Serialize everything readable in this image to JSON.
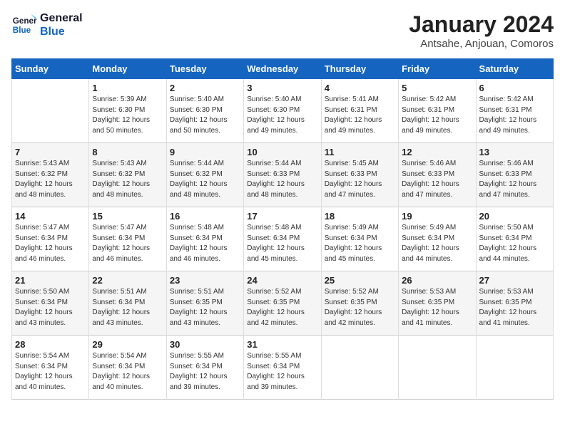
{
  "logo": {
    "line1": "General",
    "line2": "Blue"
  },
  "title": "January 2024",
  "subtitle": "Antsahe, Anjouan, Comoros",
  "days_of_week": [
    "Sunday",
    "Monday",
    "Tuesday",
    "Wednesday",
    "Thursday",
    "Friday",
    "Saturday"
  ],
  "weeks": [
    [
      {
        "num": "",
        "info": ""
      },
      {
        "num": "1",
        "info": "Sunrise: 5:39 AM\nSunset: 6:30 PM\nDaylight: 12 hours\nand 50 minutes."
      },
      {
        "num": "2",
        "info": "Sunrise: 5:40 AM\nSunset: 6:30 PM\nDaylight: 12 hours\nand 50 minutes."
      },
      {
        "num": "3",
        "info": "Sunrise: 5:40 AM\nSunset: 6:30 PM\nDaylight: 12 hours\nand 49 minutes."
      },
      {
        "num": "4",
        "info": "Sunrise: 5:41 AM\nSunset: 6:31 PM\nDaylight: 12 hours\nand 49 minutes."
      },
      {
        "num": "5",
        "info": "Sunrise: 5:42 AM\nSunset: 6:31 PM\nDaylight: 12 hours\nand 49 minutes."
      },
      {
        "num": "6",
        "info": "Sunrise: 5:42 AM\nSunset: 6:31 PM\nDaylight: 12 hours\nand 49 minutes."
      }
    ],
    [
      {
        "num": "7",
        "info": "Sunrise: 5:43 AM\nSunset: 6:32 PM\nDaylight: 12 hours\nand 48 minutes."
      },
      {
        "num": "8",
        "info": "Sunrise: 5:43 AM\nSunset: 6:32 PM\nDaylight: 12 hours\nand 48 minutes."
      },
      {
        "num": "9",
        "info": "Sunrise: 5:44 AM\nSunset: 6:32 PM\nDaylight: 12 hours\nand 48 minutes."
      },
      {
        "num": "10",
        "info": "Sunrise: 5:44 AM\nSunset: 6:33 PM\nDaylight: 12 hours\nand 48 minutes."
      },
      {
        "num": "11",
        "info": "Sunrise: 5:45 AM\nSunset: 6:33 PM\nDaylight: 12 hours\nand 47 minutes."
      },
      {
        "num": "12",
        "info": "Sunrise: 5:46 AM\nSunset: 6:33 PM\nDaylight: 12 hours\nand 47 minutes."
      },
      {
        "num": "13",
        "info": "Sunrise: 5:46 AM\nSunset: 6:33 PM\nDaylight: 12 hours\nand 47 minutes."
      }
    ],
    [
      {
        "num": "14",
        "info": "Sunrise: 5:47 AM\nSunset: 6:34 PM\nDaylight: 12 hours\nand 46 minutes."
      },
      {
        "num": "15",
        "info": "Sunrise: 5:47 AM\nSunset: 6:34 PM\nDaylight: 12 hours\nand 46 minutes."
      },
      {
        "num": "16",
        "info": "Sunrise: 5:48 AM\nSunset: 6:34 PM\nDaylight: 12 hours\nand 46 minutes."
      },
      {
        "num": "17",
        "info": "Sunrise: 5:48 AM\nSunset: 6:34 PM\nDaylight: 12 hours\nand 45 minutes."
      },
      {
        "num": "18",
        "info": "Sunrise: 5:49 AM\nSunset: 6:34 PM\nDaylight: 12 hours\nand 45 minutes."
      },
      {
        "num": "19",
        "info": "Sunrise: 5:49 AM\nSunset: 6:34 PM\nDaylight: 12 hours\nand 44 minutes."
      },
      {
        "num": "20",
        "info": "Sunrise: 5:50 AM\nSunset: 6:34 PM\nDaylight: 12 hours\nand 44 minutes."
      }
    ],
    [
      {
        "num": "21",
        "info": "Sunrise: 5:50 AM\nSunset: 6:34 PM\nDaylight: 12 hours\nand 43 minutes."
      },
      {
        "num": "22",
        "info": "Sunrise: 5:51 AM\nSunset: 6:34 PM\nDaylight: 12 hours\nand 43 minutes."
      },
      {
        "num": "23",
        "info": "Sunrise: 5:51 AM\nSunset: 6:35 PM\nDaylight: 12 hours\nand 43 minutes."
      },
      {
        "num": "24",
        "info": "Sunrise: 5:52 AM\nSunset: 6:35 PM\nDaylight: 12 hours\nand 42 minutes."
      },
      {
        "num": "25",
        "info": "Sunrise: 5:52 AM\nSunset: 6:35 PM\nDaylight: 12 hours\nand 42 minutes."
      },
      {
        "num": "26",
        "info": "Sunrise: 5:53 AM\nSunset: 6:35 PM\nDaylight: 12 hours\nand 41 minutes."
      },
      {
        "num": "27",
        "info": "Sunrise: 5:53 AM\nSunset: 6:35 PM\nDaylight: 12 hours\nand 41 minutes."
      }
    ],
    [
      {
        "num": "28",
        "info": "Sunrise: 5:54 AM\nSunset: 6:34 PM\nDaylight: 12 hours\nand 40 minutes."
      },
      {
        "num": "29",
        "info": "Sunrise: 5:54 AM\nSunset: 6:34 PM\nDaylight: 12 hours\nand 40 minutes."
      },
      {
        "num": "30",
        "info": "Sunrise: 5:55 AM\nSunset: 6:34 PM\nDaylight: 12 hours\nand 39 minutes."
      },
      {
        "num": "31",
        "info": "Sunrise: 5:55 AM\nSunset: 6:34 PM\nDaylight: 12 hours\nand 39 minutes."
      },
      {
        "num": "",
        "info": ""
      },
      {
        "num": "",
        "info": ""
      },
      {
        "num": "",
        "info": ""
      }
    ]
  ]
}
